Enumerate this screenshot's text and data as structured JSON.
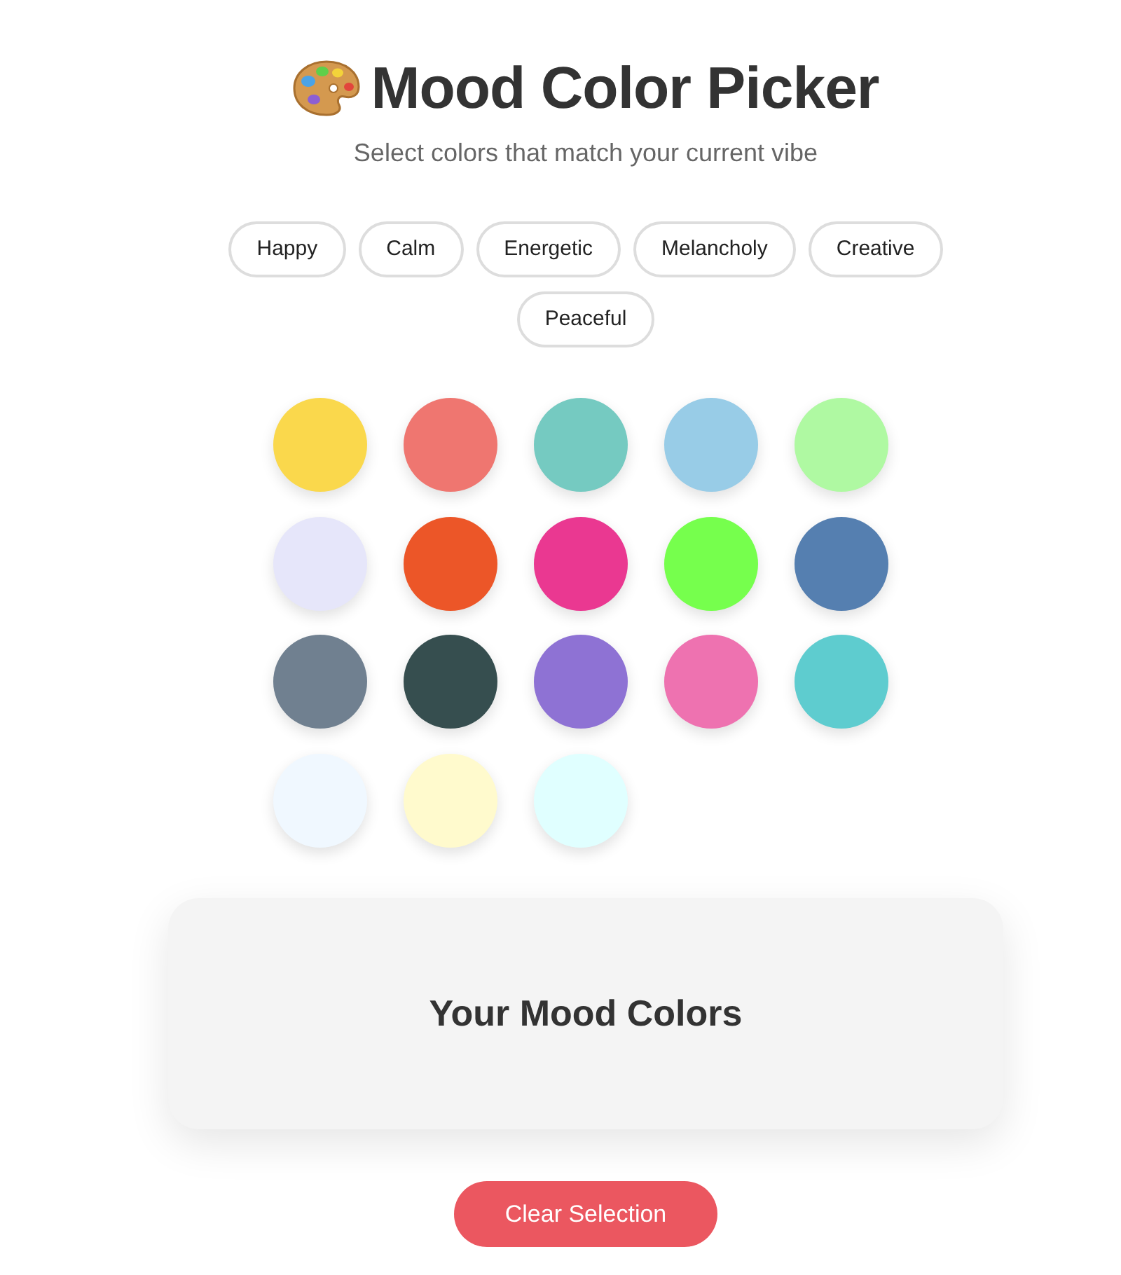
{
  "header": {
    "title": "Mood Color Picker",
    "subtitle": "Select colors that match your current vibe"
  },
  "moods": [
    {
      "label": "Happy",
      "selected": false
    },
    {
      "label": "Calm",
      "selected": false
    },
    {
      "label": "Energetic",
      "selected": false
    },
    {
      "label": "Melancholy",
      "selected": false
    },
    {
      "label": "Creative",
      "selected": false
    },
    {
      "label": "Peaceful",
      "selected": false
    }
  ],
  "swatches": [
    {
      "color": "#fad84c",
      "selected": false
    },
    {
      "color": "#ef7670",
      "selected": false
    },
    {
      "color": "#75cac1",
      "selected": false
    },
    {
      "color": "#98cce7",
      "selected": false
    },
    {
      "color": "#aff9a2",
      "selected": false
    },
    {
      "color": "#e6e6fa",
      "selected": false
    },
    {
      "color": "#ec5628",
      "selected": false
    },
    {
      "color": "#ea3891",
      "selected": false
    },
    {
      "color": "#76ff4d",
      "selected": false
    },
    {
      "color": "#557fb0",
      "selected": false
    },
    {
      "color": "#708090",
      "selected": false
    },
    {
      "color": "#364e4f",
      "selected": false
    },
    {
      "color": "#8e72d4",
      "selected": false
    },
    {
      "color": "#ee72b0",
      "selected": false
    },
    {
      "color": "#5ecccf",
      "selected": false
    },
    {
      "color": "#f0f8ff",
      "selected": false
    },
    {
      "color": "#fffacd",
      "selected": false
    },
    {
      "color": "#e0ffff",
      "selected": false
    }
  ],
  "panel": {
    "title": "Your Mood Colors"
  },
  "clear_button": {
    "label": "Clear Selection"
  }
}
